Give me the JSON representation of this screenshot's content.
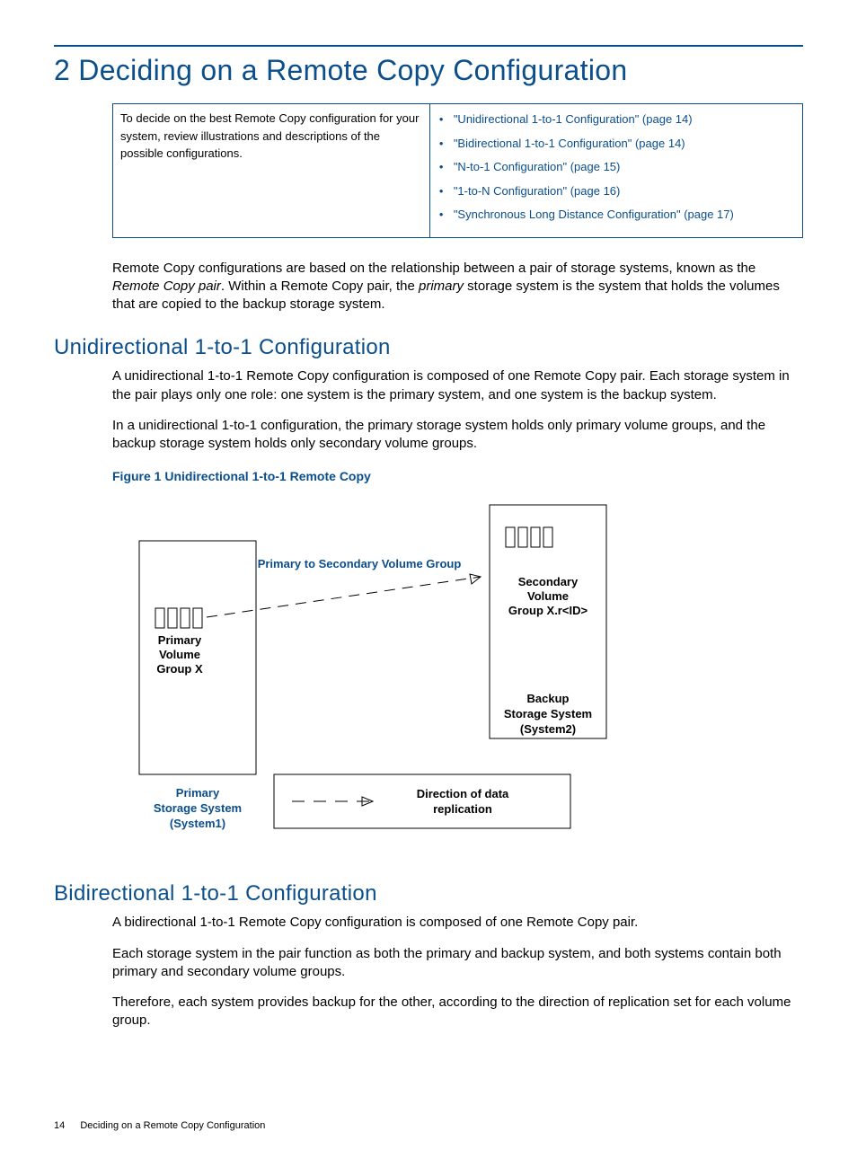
{
  "chapter_title": "2 Deciding on a Remote Copy Configuration",
  "box": {
    "left_text": "To decide on the best Remote Copy configuration for your system, review illustrations and descriptions of the possible configurations.",
    "links": [
      "\"Unidirectional 1-to-1 Configuration\" (page 14)",
      "\"Bidirectional 1-to-1 Configuration\" (page 14)",
      "\"N-to-1 Configuration\" (page 15)",
      "\"1-to-N Configuration\" (page 16)",
      "\"Synchronous Long Distance Configuration\" (page 17)"
    ]
  },
  "intro_p": "Remote Copy configurations are based on the relationship between a pair of storage systems, known as the Remote Copy pair. Within a Remote Copy pair, the primary storage system is the system that holds the volumes that are copied to the backup storage system.",
  "section1": {
    "title": "Unidirectional 1-to-1 Configuration",
    "p1": "A unidirectional 1-to-1 Remote Copy configuration is composed of one Remote Copy pair. Each storage system in the pair plays only one role: one system is the primary system, and one system is the backup system.",
    "p2": "In a unidirectional 1-to-1 configuration, the primary storage system holds only primary volume groups, and the backup storage system holds only secondary volume groups.",
    "fig_caption": "Figure 1 Unidirectional 1-to-1 Remote Copy",
    "fig": {
      "arrow_label": "Primary to Secondary Volume Group",
      "primary_vg_l1": "Primary",
      "primary_vg_l2": "Volume",
      "primary_vg_l3": "Group X",
      "secondary_vg_l1": "Secondary",
      "secondary_vg_l2": "Volume",
      "secondary_vg_l3": "Group X.r<ID>",
      "primary_sys_l1": "Primary",
      "primary_sys_l2": "Storage System",
      "primary_sys_l3": "(System1)",
      "backup_sys_l1": "Backup",
      "backup_sys_l2": "Storage System",
      "backup_sys_l3": "(System2)",
      "legend_l1": "Direction of data",
      "legend_l2": "replication"
    }
  },
  "section2": {
    "title": "Bidirectional 1-to-1 Configuration",
    "p1": "A bidirectional 1-to-1 Remote Copy configuration is composed of one Remote Copy pair.",
    "p2": "Each storage system in the pair function as both the primary and backup system, and both systems contain both primary and secondary volume groups.",
    "p3": "Therefore, each system provides backup for the other, according to the direction of replication set for each volume group."
  },
  "footer": {
    "page": "14",
    "title": "Deciding on a Remote Copy Configuration"
  }
}
